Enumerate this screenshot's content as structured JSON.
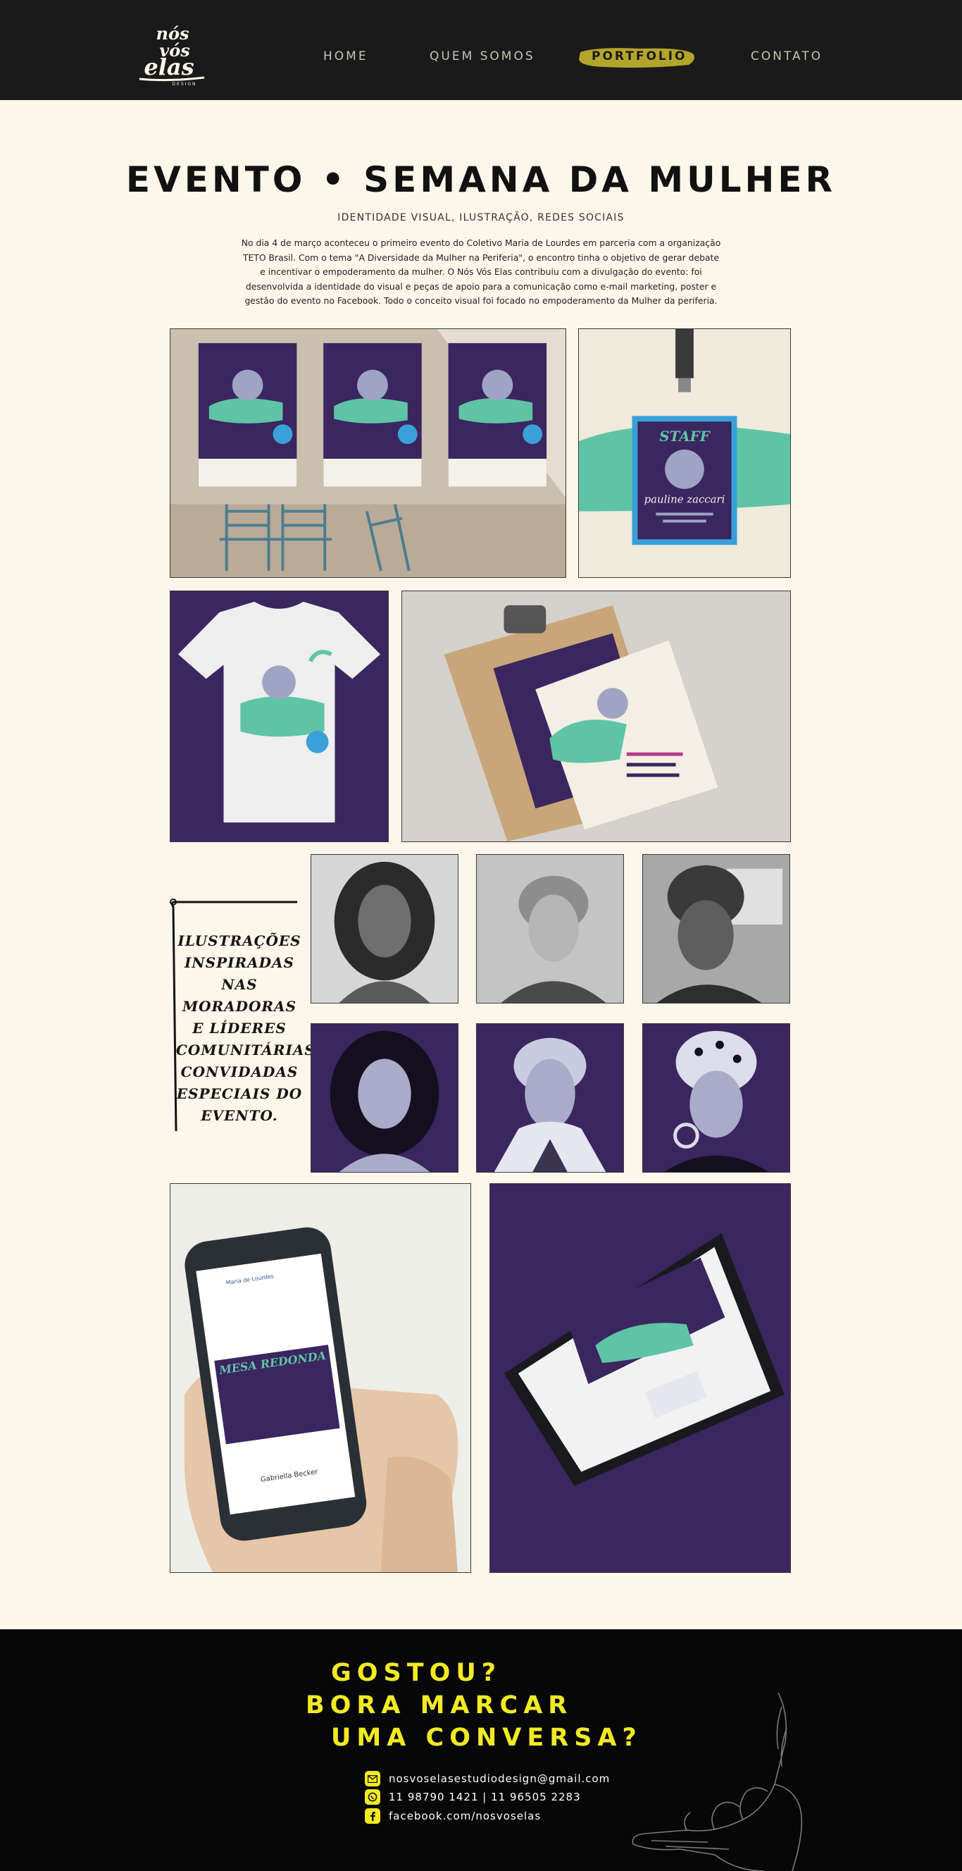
{
  "header": {
    "logo_text": "nós vós elas",
    "logo_sub": "DESIGN",
    "nav": [
      {
        "label": "HOME"
      },
      {
        "label": "QUEM SOMOS"
      },
      {
        "label": "PORTFOLIO"
      },
      {
        "label": "CONTATO"
      }
    ],
    "active_nav": "PORTFOLIO"
  },
  "project": {
    "title": "EVENTO • SEMANA DA MULHER",
    "subtitle": "IDENTIDADE VISUAL, ILUSTRAÇÃO, REDES SOCIAIS",
    "description_lines": [
      "No dia 4 de março aconteceu o primeiro evento do Coletivo Maria de Lourdes em parceria com a organização",
      "TETO Brasil. Com o tema \"A Diversidade da Mulher na Periferia\", o encontro tinha o objetivo de gerar debate",
      "e incentivar o empoderamento da mulher. O Nós Vós Elas contribuiu com a divulgação do evento: foi",
      "desenvolvida a identidade do visual e peças de apoio para a comunicação como e-mail marketing, poster e",
      "gestão do evento no Facebook. Todo o conceito visual foi focado no empoderamento da Mulher da periferia."
    ]
  },
  "gallery": {
    "staff_badge": {
      "title": "STAFF",
      "name": "pauline zaccari"
    },
    "side_text_lines": [
      "ILUSTRAÇÕES",
      "INSPIRADAS NAS",
      "MORADORAS",
      "E LÍDERES",
      "COMUNITÁRIAS:",
      "CONVIDADAS",
      "ESPECIAIS DO",
      "EVENTO."
    ],
    "phone_post": {
      "page_name": "Maria de Lourdes",
      "banner": "MESA REDONDA",
      "commenter": "Gabriella Becker"
    }
  },
  "footer": {
    "cta_lines": [
      "GOSTOU?",
      "BORA MARCAR",
      "UMA CONVERSA?"
    ],
    "email": "nosvoselasestudiodesign@gmail.com",
    "phone": "11 98790 1421 | 11 96505 2283",
    "facebook": "facebook.com/nosvoselas"
  },
  "colors": {
    "brand_purple": "#3b2660",
    "brand_mint": "#5fc4a6",
    "accent_yellow": "#f2ea22",
    "cream": "#fdf6ea",
    "dark": "#1a1a1a"
  }
}
